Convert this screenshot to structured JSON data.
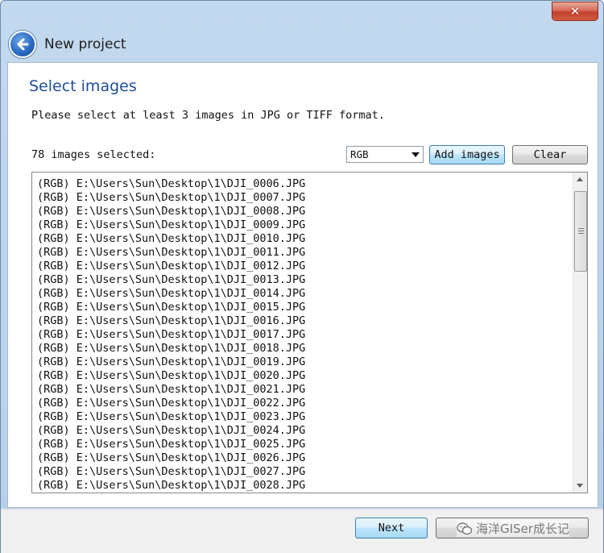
{
  "window": {
    "title": "New project",
    "close_glyph": "✕"
  },
  "page": {
    "title": "Select images",
    "instructions": "Please select at least 3 images in JPG or TIFF format.",
    "count_label": "78 images selected:"
  },
  "controls": {
    "color_mode": {
      "selected": "RGB",
      "icon": "chevron-down-icon"
    },
    "add_images_label": "Add images",
    "clear_label": "Clear"
  },
  "image_list": [
    "(RGB) E:\\Users\\Sun\\Desktop\\1\\DJI_0006.JPG",
    "(RGB) E:\\Users\\Sun\\Desktop\\1\\DJI_0007.JPG",
    "(RGB) E:\\Users\\Sun\\Desktop\\1\\DJI_0008.JPG",
    "(RGB) E:\\Users\\Sun\\Desktop\\1\\DJI_0009.JPG",
    "(RGB) E:\\Users\\Sun\\Desktop\\1\\DJI_0010.JPG",
    "(RGB) E:\\Users\\Sun\\Desktop\\1\\DJI_0011.JPG",
    "(RGB) E:\\Users\\Sun\\Desktop\\1\\DJI_0012.JPG",
    "(RGB) E:\\Users\\Sun\\Desktop\\1\\DJI_0013.JPG",
    "(RGB) E:\\Users\\Sun\\Desktop\\1\\DJI_0014.JPG",
    "(RGB) E:\\Users\\Sun\\Desktop\\1\\DJI_0015.JPG",
    "(RGB) E:\\Users\\Sun\\Desktop\\1\\DJI_0016.JPG",
    "(RGB) E:\\Users\\Sun\\Desktop\\1\\DJI_0017.JPG",
    "(RGB) E:\\Users\\Sun\\Desktop\\1\\DJI_0018.JPG",
    "(RGB) E:\\Users\\Sun\\Desktop\\1\\DJI_0019.JPG",
    "(RGB) E:\\Users\\Sun\\Desktop\\1\\DJI_0020.JPG",
    "(RGB) E:\\Users\\Sun\\Desktop\\1\\DJI_0021.JPG",
    "(RGB) E:\\Users\\Sun\\Desktop\\1\\DJI_0022.JPG",
    "(RGB) E:\\Users\\Sun\\Desktop\\1\\DJI_0023.JPG",
    "(RGB) E:\\Users\\Sun\\Desktop\\1\\DJI_0024.JPG",
    "(RGB) E:\\Users\\Sun\\Desktop\\1\\DJI_0025.JPG",
    "(RGB) E:\\Users\\Sun\\Desktop\\1\\DJI_0026.JPG",
    "(RGB) E:\\Users\\Sun\\Desktop\\1\\DJI_0027.JPG",
    "(RGB) E:\\Users\\Sun\\Desktop\\1\\DJI_0028.JPG"
  ],
  "footer": {
    "next_label": "Next",
    "cancel_label": "",
    "watermark_text": "海洋GISer成长记"
  },
  "colors": {
    "title_bar": "#b9d1ea",
    "title_text": "#1f4f9a",
    "close_button": "#c7432c",
    "accent_button": "#bee6fd"
  },
  "icons": {
    "back": "back-arrow-icon",
    "close": "close-icon",
    "watermark": "wechat-icon"
  }
}
